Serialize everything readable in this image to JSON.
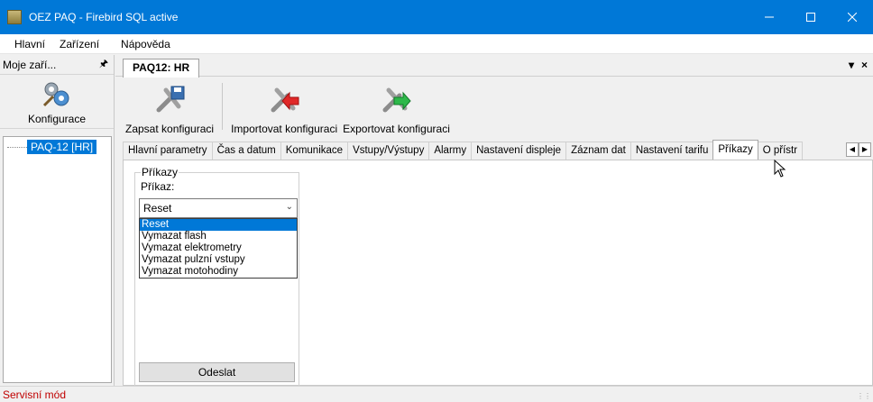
{
  "window": {
    "title": "OEZ PAQ - Firebird SQL active",
    "minimize_icon": "minimize-icon",
    "maximize_icon": "maximize-icon",
    "close_icon": "close-icon"
  },
  "menu": [
    "Hlavní",
    "Zařízení",
    "Nápověda"
  ],
  "left_dock": {
    "title": "Moje zaří...",
    "pin_icon": "pin-icon",
    "toolbar_label": "Konfigurace",
    "tree_item": "PAQ-12 [HR]"
  },
  "document": {
    "tab_label": "PAQ12: HR",
    "menu_arrow": "▾",
    "close": "×"
  },
  "toolbar": {
    "save": "Zapsat konfiguraci",
    "import": "Importovat konfiguraci",
    "export": "Exportovat konfiguraci"
  },
  "inner_tabs": [
    "Hlavní parametry",
    "Čas a datum",
    "Komunikace",
    "Vstupy/Výstupy",
    "Alarmy",
    "Nastavení displeje",
    "Záznam dat",
    "Nastavení tarifu",
    "Příkazy",
    "O přístr"
  ],
  "active_inner_tab": "Příkazy",
  "commands": {
    "group_title": "Příkazy",
    "field_label": "Příkaz:",
    "selected": "Reset",
    "options": [
      "Reset",
      "Vymazat flash",
      "Vymazat elektrometry",
      "Vymazat pulzní vstupy",
      "Vymazat motohodiny"
    ],
    "send_button": "Odeslat"
  },
  "status": "Servisní mód",
  "colors": {
    "titlebar": "#0078d7",
    "selection": "#0078d7",
    "status_text": "#c00000"
  }
}
